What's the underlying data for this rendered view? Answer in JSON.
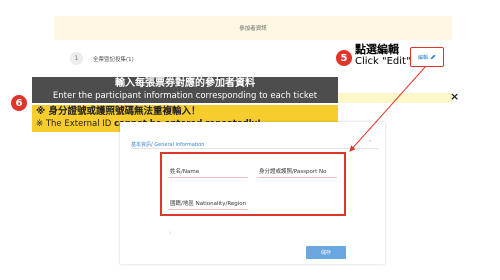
{
  "header": {
    "title": "參加者資訊"
  },
  "participant_row": {
    "index": "1",
    "label": "全票暨記投集(1)",
    "edit_link": "編輯"
  },
  "callout_edit": {
    "step": "5",
    "zh": "點選編輯",
    "en": "Click \"Edit\""
  },
  "callout_info": {
    "step": "6",
    "zh": "輸入每張票券對應的參加者資料",
    "en": "Enter the participant information corresponding to each ticket"
  },
  "warning": {
    "line1": "※ 身分證號或護照號碼無法重複輸入！",
    "line2_prefix": "※ The External ID ",
    "line2_bold": "cannot be entered repeatedly!"
  },
  "modal": {
    "close": "×",
    "section_title": "基本資訊/ General information",
    "fields": {
      "name_label": "姓名/Name",
      "id_label": "身分證或護照/Passport No",
      "nationality_label": "國籍/地區 Nationality/Region"
    },
    "submit_label": "儲存"
  },
  "colors": {
    "accent_red": "#e0352b",
    "warning_yellow": "#f7cc2d",
    "primary_blue": "#6aa6df"
  }
}
